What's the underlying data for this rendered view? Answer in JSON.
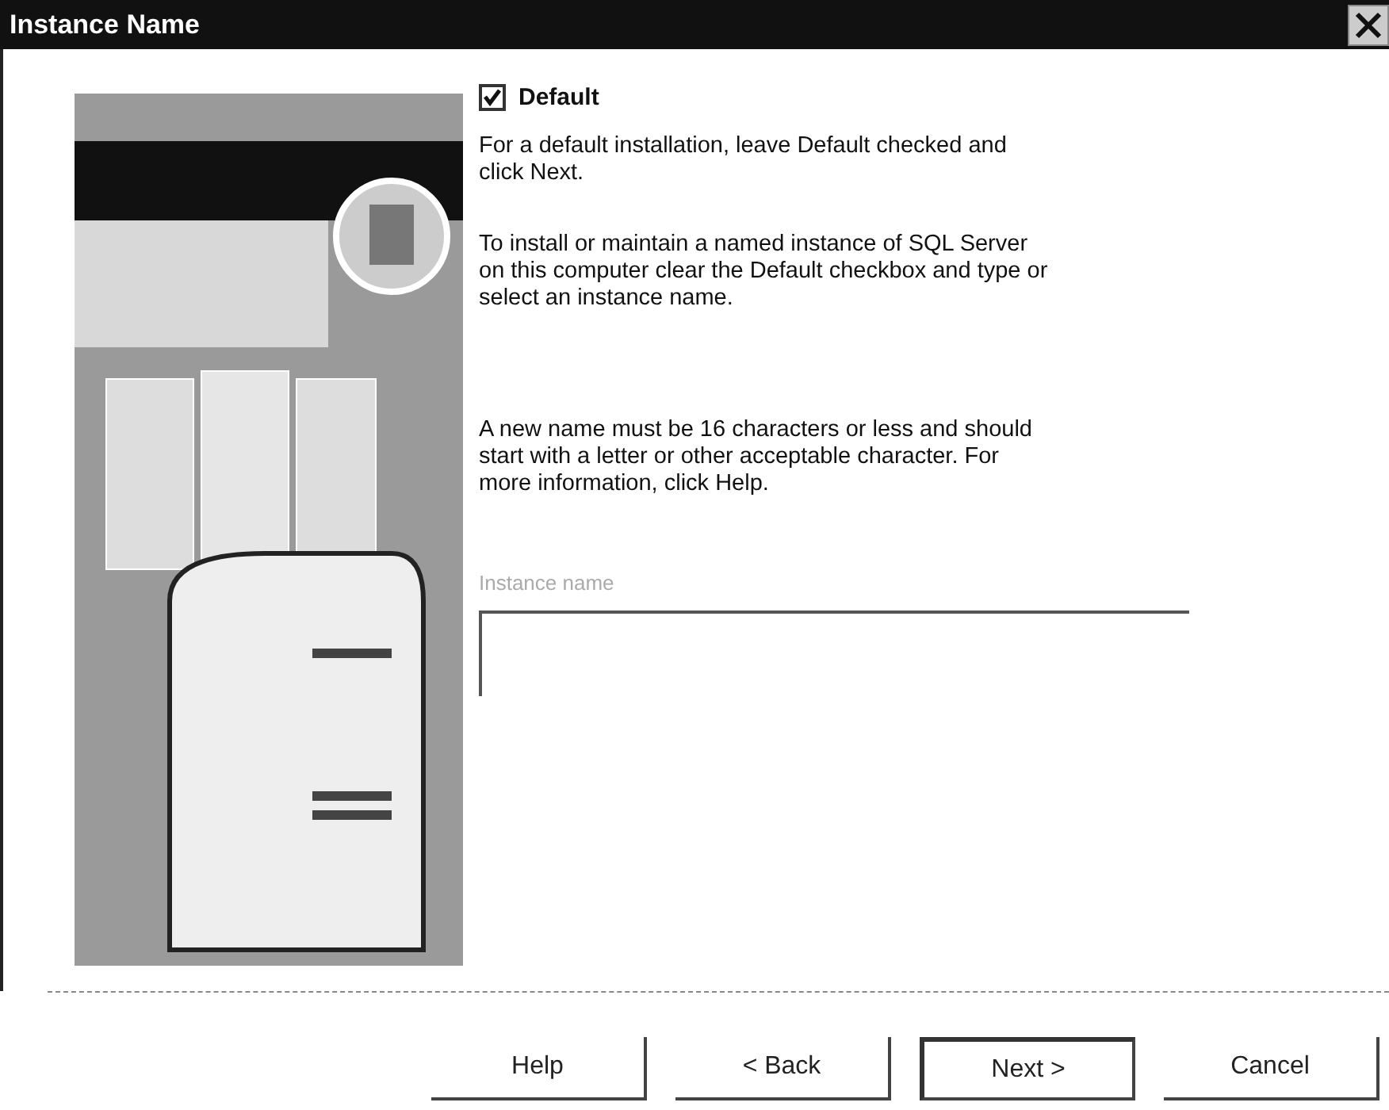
{
  "window": {
    "title": "Instance Name"
  },
  "default_checkbox": {
    "label": "Default",
    "checked": true
  },
  "paragraphs": [
    "For a default installation, leave Default checked and click Next.",
    "To install or maintain a named instance of SQL Server on this computer clear the Default checkbox and type or select an instance name.",
    "A new name must be 16 characters or less and should start with a letter or other acceptable character.  For more information, click Help."
  ],
  "instance_name": {
    "label": "Instance name",
    "disabled": true
  },
  "buttons": [
    {
      "label": "Help",
      "default": false
    },
    {
      "label": "< Back",
      "default": false
    },
    {
      "label": "Next >",
      "default": true
    },
    {
      "label": "Cancel",
      "default": false
    }
  ]
}
